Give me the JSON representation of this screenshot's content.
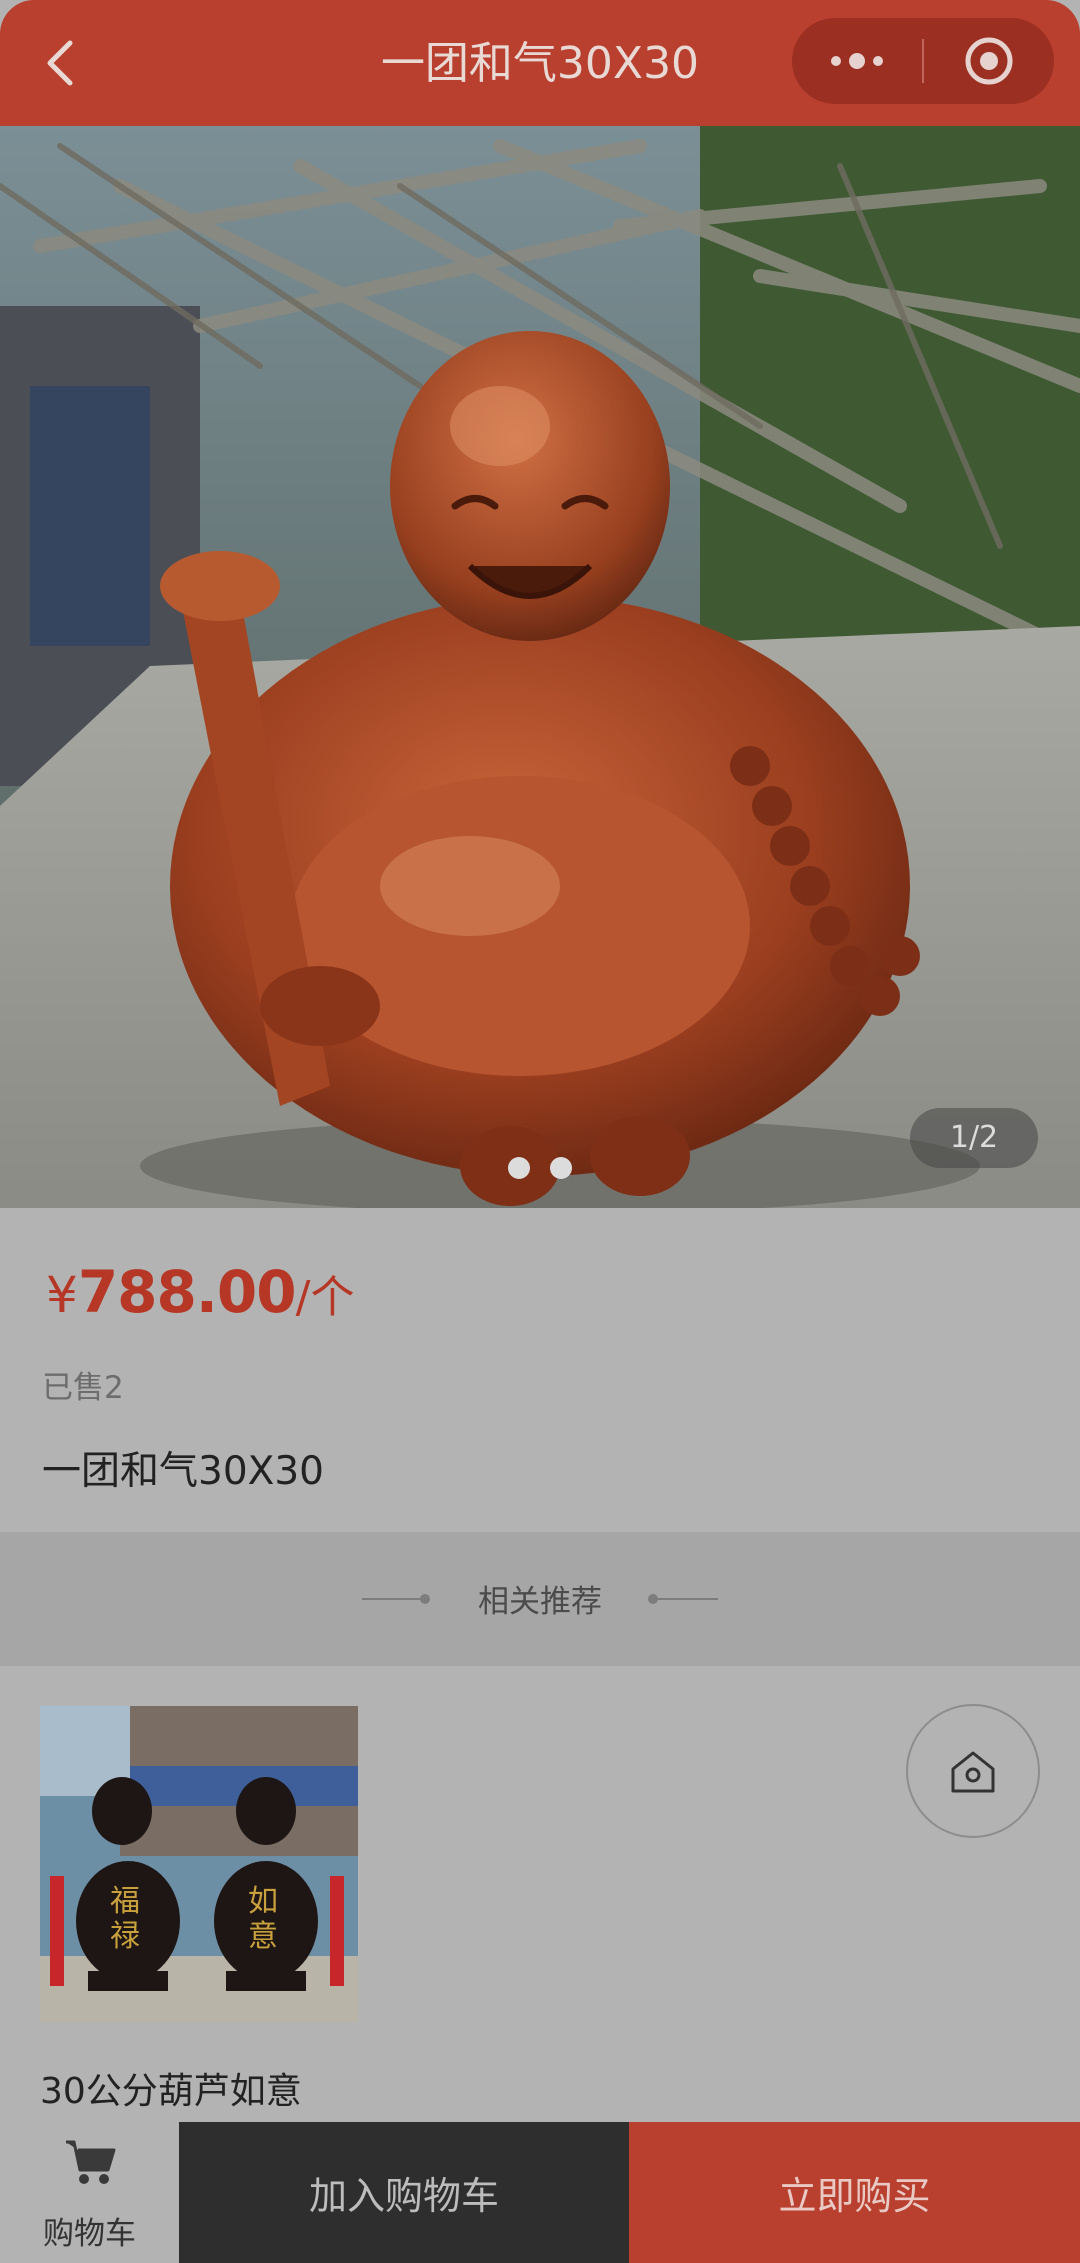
{
  "header": {
    "title": "一团和气30X30"
  },
  "gallery": {
    "counter": "1/2"
  },
  "product": {
    "currency": "¥",
    "price": "788.00",
    "unit": "/个",
    "sold": "已售2",
    "name": "一团和气30X30"
  },
  "related": {
    "title": "相关推荐",
    "items": [
      {
        "name": "30公分葫芦如意"
      }
    ]
  },
  "bottom": {
    "cart_label": "购物车",
    "add_cart_label": "加入购物车",
    "buy_label": "立即购买"
  },
  "colors": {
    "brand": "#b9402f",
    "price": "#b63726",
    "dark_button": "#2e2e2e"
  }
}
